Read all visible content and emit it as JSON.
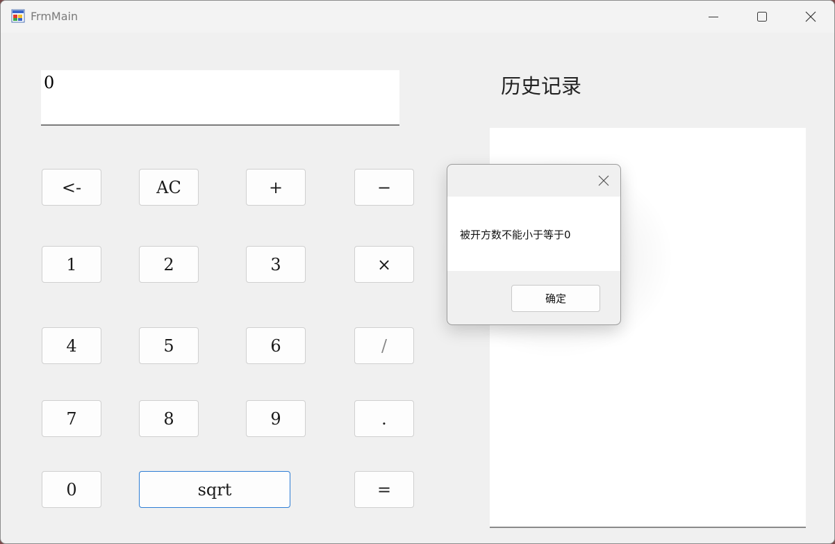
{
  "window": {
    "title": "FrmMain",
    "icons": {
      "app": "winforms-app-icon",
      "minimize": "minimize-icon",
      "maximize": "maximize-icon",
      "close": "close-icon"
    }
  },
  "display": {
    "value": "0"
  },
  "history": {
    "label": "历史记录"
  },
  "keys": {
    "backspace": "<-",
    "clear": "AC",
    "add": "+",
    "subtract": "−",
    "one": "1",
    "two": "2",
    "three": "3",
    "multiply": "×",
    "four": "4",
    "five": "5",
    "six": "6",
    "divide": "/",
    "seven": "7",
    "eight": "8",
    "nine": "9",
    "dot": ".",
    "zero": "0",
    "sqrt": "sqrt",
    "equals": "="
  },
  "dialog": {
    "message": "被开方数不能小于等于0",
    "ok_label": "确定"
  },
  "colors": {
    "window_bg": "#f0f0f0",
    "focus_border": "#2a7bd4"
  }
}
